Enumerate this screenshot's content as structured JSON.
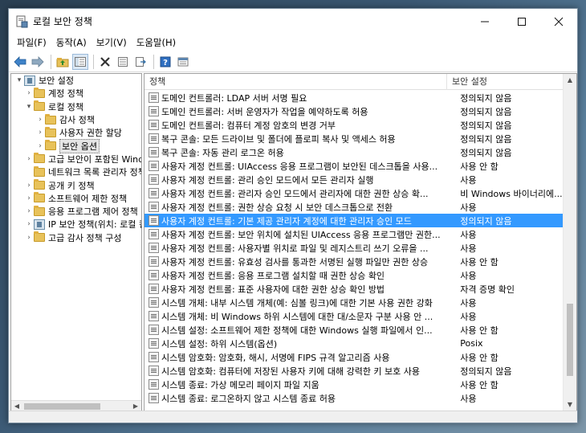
{
  "window": {
    "title": "로컬 보안 정책",
    "controls": {
      "minimize": "—",
      "maximize": "☐",
      "close": "✕"
    }
  },
  "menu": [
    "파일(F)",
    "동작(A)",
    "보기(V)",
    "도움말(H)"
  ],
  "toolbar": {
    "icons": [
      "back-arrow-icon",
      "forward-arrow-icon",
      "up-folder-icon",
      "show-tree-icon",
      "delete-icon",
      "properties-icon",
      "export-icon",
      "help-icon",
      "console-icon"
    ]
  },
  "tree": {
    "items": [
      {
        "label": "보안 설정",
        "level": 0,
        "icon": "security-settings-icon",
        "chevron": "▾"
      },
      {
        "label": "계정 정책",
        "level": 1,
        "icon": "folder-icon",
        "chevron": "›"
      },
      {
        "label": "로컬 정책",
        "level": 1,
        "icon": "folder-icon",
        "chevron": "▾"
      },
      {
        "label": "감사 정책",
        "level": 2,
        "icon": "folder-icon",
        "chevron": "›"
      },
      {
        "label": "사용자 권한 할당",
        "level": 2,
        "icon": "folder-icon",
        "chevron": "›"
      },
      {
        "label": "보안 옵션",
        "level": 2,
        "icon": "folder-icon",
        "chevron": "›",
        "selected": true
      },
      {
        "label": "고급 보안이 포함된 Windows",
        "level": 1,
        "icon": "folder-icon",
        "chevron": "›"
      },
      {
        "label": "네트워크 목록 관리자 정책",
        "level": 1,
        "icon": "folder-icon",
        "chevron": ""
      },
      {
        "label": "공개 키 정책",
        "level": 1,
        "icon": "folder-icon",
        "chevron": "›"
      },
      {
        "label": "소프트웨어 제한 정책",
        "level": 1,
        "icon": "folder-icon",
        "chevron": "›"
      },
      {
        "label": "응용 프로그램 제어 정책",
        "level": 1,
        "icon": "folder-icon",
        "chevron": "›"
      },
      {
        "label": "IP 보안 정책(위치: 로컬 컴",
        "level": 1,
        "icon": "ip-security-icon",
        "chevron": "›"
      },
      {
        "label": "고급 감사 정책 구성",
        "level": 1,
        "icon": "folder-icon",
        "chevron": "›"
      }
    ]
  },
  "list": {
    "headers": {
      "policy": "정책",
      "setting": "보안 설정"
    },
    "rows": [
      {
        "policy": "도메인 컨트롤러: LDAP 서버 서명 필요",
        "setting": "정의되지 않음"
      },
      {
        "policy": "도메인 컨트롤러: 서버 운영자가 작업을 예약하도록 허용",
        "setting": "정의되지 않음"
      },
      {
        "policy": "도메인 컨트롤러: 컴퓨터 계정 암호의 변경 거부",
        "setting": "정의되지 않음"
      },
      {
        "policy": "복구 콘솔: 모든 드라이브 및 폴더에 플로피 복사 및 액세스 허용",
        "setting": "정의되지 않음"
      },
      {
        "policy": "복구 콘솔: 자동 관리 로그온 허용",
        "setting": "정의되지 않음"
      },
      {
        "policy": "사용자 계정 컨트롤: UIAccess 응용 프로그램이 보안된 데스크톱을 사용...",
        "setting": "사용 안 함"
      },
      {
        "policy": "사용자 계정 컨트롤: 관리 승인 모드에서 모든 관리자 실행",
        "setting": "사용"
      },
      {
        "policy": "사용자 계정 컨트롤: 관리자 승인 모드에서 관리자에 대한 권한 상승 확...",
        "setting": "비 Windows 바이너리에..."
      },
      {
        "policy": "사용자 계정 컨트롤: 권한 상승 요청 시 보안 데스크톱으로 전환",
        "setting": "사용"
      },
      {
        "policy": "사용자 계정 컨트롤: 기본 제공 관리자 계정에 대한 관리자 승인 모드",
        "setting": "정의되지 않음",
        "selected": true
      },
      {
        "policy": "사용자 계정 컨트롤: 보안 위치에 설치된 UIAccess 응용 프로그램만 권한...",
        "setting": "사용"
      },
      {
        "policy": "사용자 계정 컨트롤: 사용자별 위치로 파일 및 레지스트리 쓰기 오류을 ...",
        "setting": "사용"
      },
      {
        "policy": "사용자 계정 컨트롤: 유효성 검사를 통과한 서명된 실행 파일만 권한 상승",
        "setting": "사용 안 함"
      },
      {
        "policy": "사용자 계정 컨트롤: 응용 프로그램 설치할 때 권한 상승 확인",
        "setting": "사용"
      },
      {
        "policy": "사용자 계정 컨트롤: 표준 사용자에 대한 권한 상승 확인 방법",
        "setting": "자격 증명 확인"
      },
      {
        "policy": "시스템 개체: 내부 시스템 개체(예: 심볼 링크)에 대한 기본 사용 권한 강화",
        "setting": "사용"
      },
      {
        "policy": "시스템 개체: 비 Windows 하위 시스템에 대한 대/소문자 구분 사용 안 ...",
        "setting": "사용"
      },
      {
        "policy": "시스템 설정: 소프트웨어 제한 정책에 대한 Windows 실행 파일에서 인...",
        "setting": "사용 안 함"
      },
      {
        "policy": "시스템 설정: 하위 시스템(옵션)",
        "setting": "Posix"
      },
      {
        "policy": "시스템 암호화: 암호화, 해시, 서명에 FIPS 규격 알고리즘 사용",
        "setting": "사용 안 함"
      },
      {
        "policy": "시스템 암호화: 컴퓨터에 저장된 사용자 키에 대해 강력한 키 보호 사용",
        "setting": "정의되지 않음"
      },
      {
        "policy": "시스템 종료: 가상 메모리 페이지 파일 지움",
        "setting": "사용 안 함"
      },
      {
        "policy": "시스템 종료: 로그온하지 않고 시스템 종료 허용",
        "setting": "사용"
      }
    ]
  },
  "colors": {
    "selection": "#3399ff",
    "folder": "#e8c25a"
  }
}
